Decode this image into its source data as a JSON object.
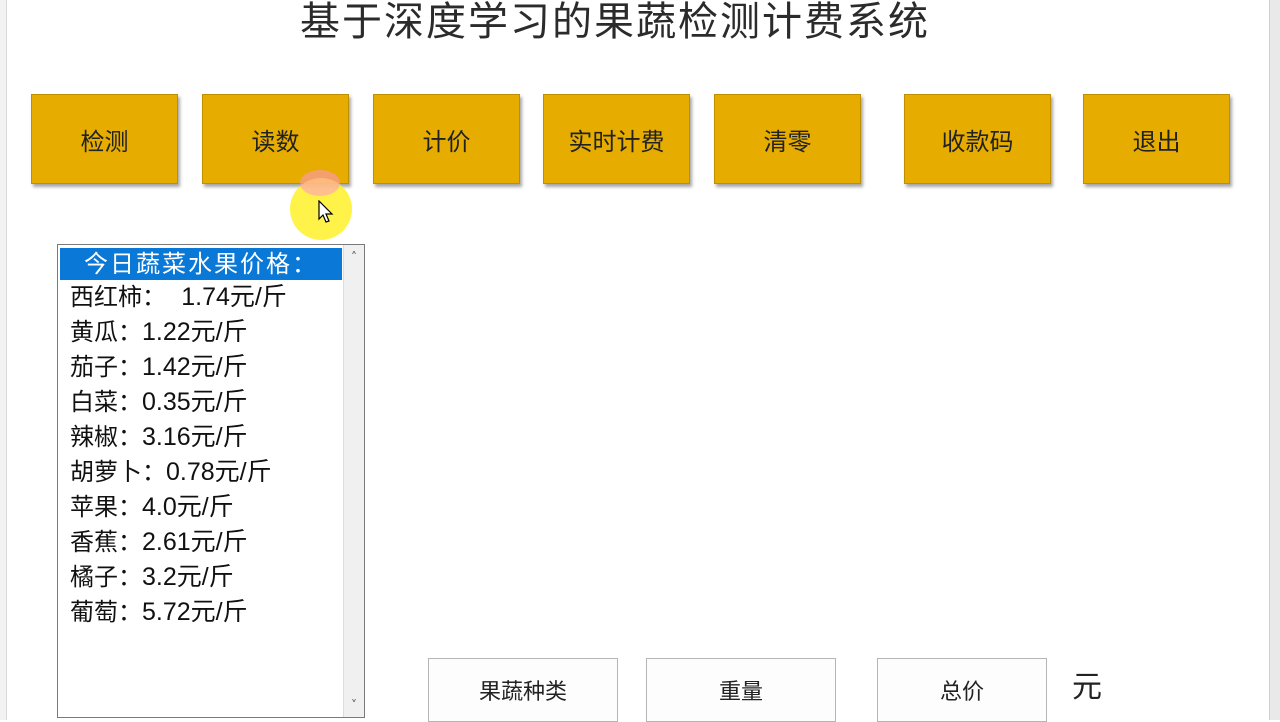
{
  "app": {
    "title": "基于深度学习的果蔬检测计费系统"
  },
  "toolbar": {
    "buttons": [
      {
        "label": "检测"
      },
      {
        "label": "读数"
      },
      {
        "label": "计价"
      },
      {
        "label": "实时计费"
      },
      {
        "label": "清零"
      },
      {
        "label": "收款码"
      },
      {
        "label": "退出"
      }
    ]
  },
  "price_list": {
    "header": "今日蔬菜水果价格：",
    "items": [
      {
        "name": "西红柿：",
        "price": "1.74元/斤"
      },
      {
        "name": "黄瓜：",
        "price": "1.22元/斤"
      },
      {
        "name": "茄子：",
        "price": "1.42元/斤"
      },
      {
        "name": "白菜：",
        "price": "0.35元/斤"
      },
      {
        "name": "辣椒：",
        "price": "3.16元/斤"
      },
      {
        "name": "胡萝卜：",
        "price": "0.78元/斤"
      },
      {
        "name": "苹果：",
        "price": "4.0元/斤"
      },
      {
        "name": "香蕉：",
        "price": "2.61元/斤"
      },
      {
        "name": "橘子：",
        "price": "3.2元/斤"
      },
      {
        "name": "葡萄：",
        "price": "5.72元/斤"
      }
    ]
  },
  "result_fields": {
    "category_label": "果蔬种类",
    "weight_label": "重量",
    "total_label": "总价",
    "unit": "元"
  },
  "colors": {
    "button_bg": "#e6ac00",
    "list_header_bg": "#0a78d7",
    "cursor_highlight": "#fff028"
  }
}
